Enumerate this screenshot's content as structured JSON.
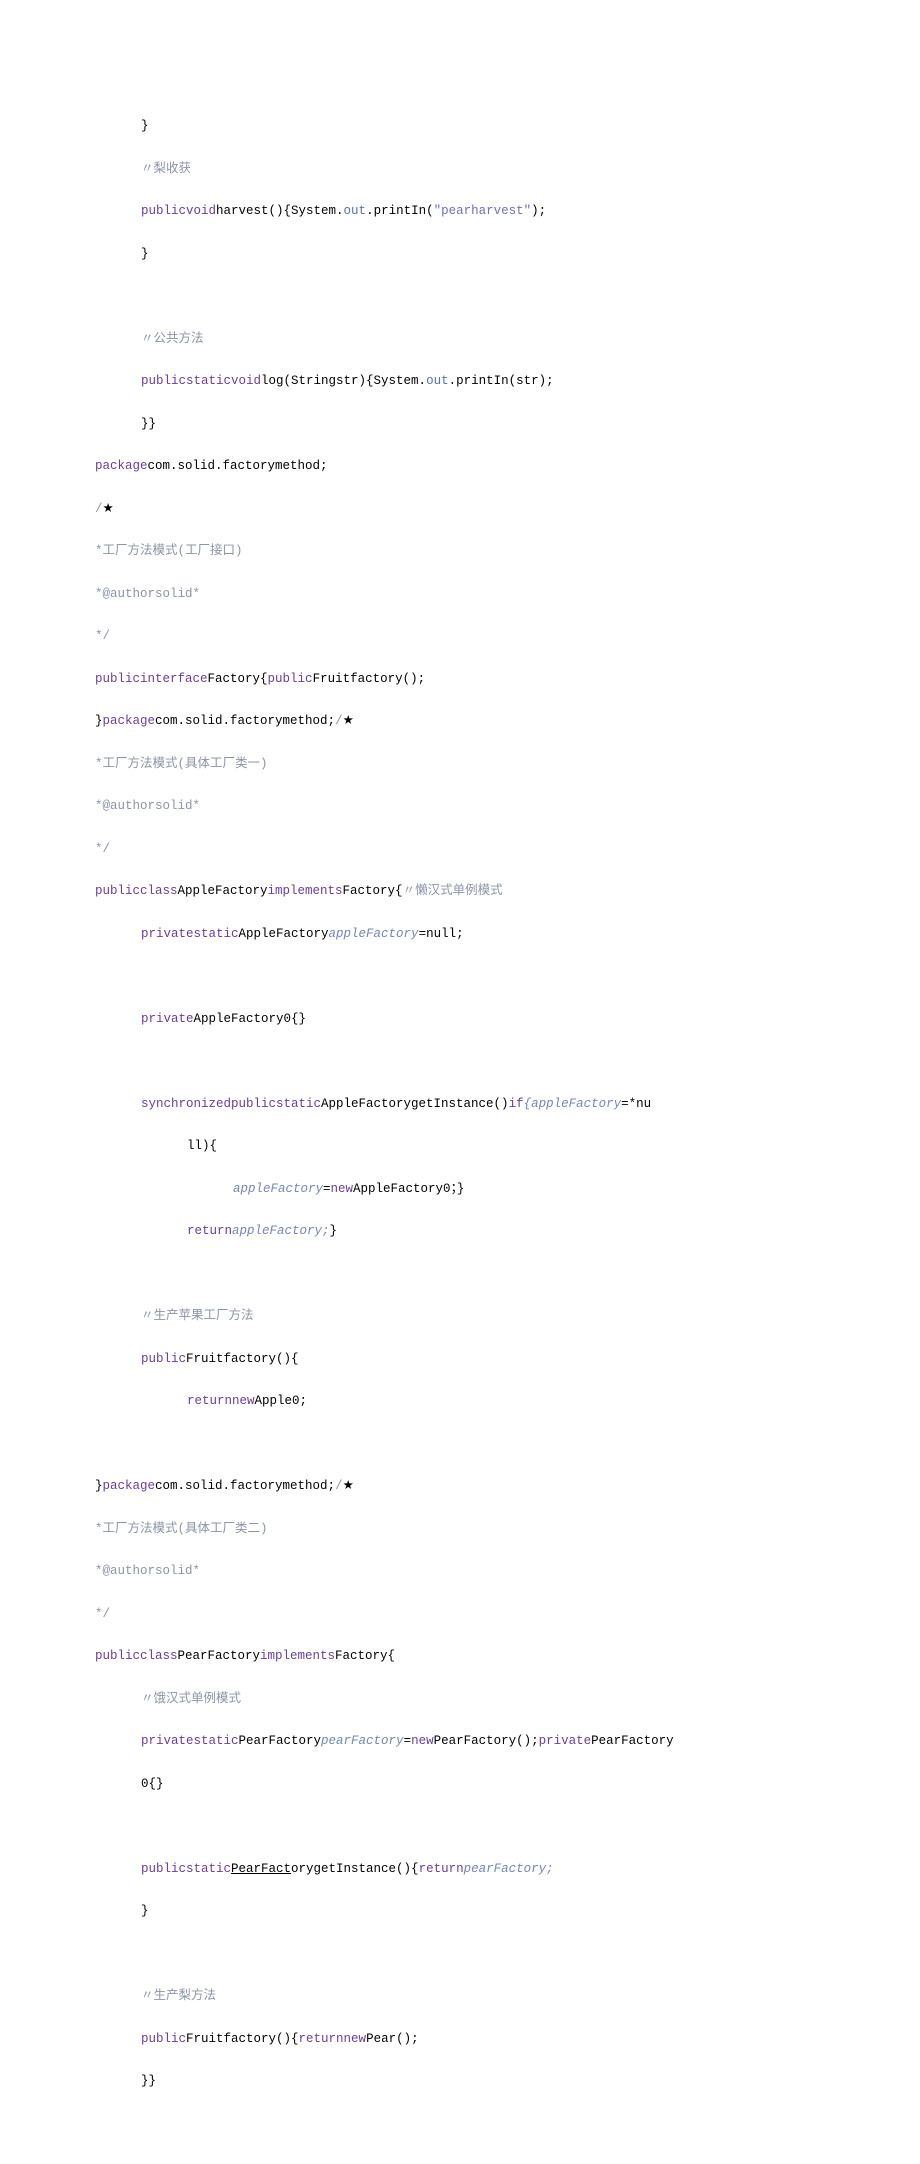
{
  "lines": {
    "l1": "}",
    "l2_cmt": "〃梨收获",
    "l3_a": "publicvoid",
    "l3_b": "harvest(){System.",
    "l3_c": "out",
    "l3_d": ".printIn(",
    "l3_e": "\"pearharvest\"",
    "l3_f": ");",
    "l4": "}",
    "l5_cmt": "〃公共方法",
    "l6_a": "publicstaticvoid",
    "l6_b": "log(Stringstr){System.",
    "l6_c": "out",
    "l6_d": ".printIn(str);",
    "l7": "}}",
    "l8_a": "package",
    "l8_b": "com.solid.factorymethod;",
    "l9_a": "/",
    "l9_star": "★",
    "l10": "*工厂方法模式(工厂接口)",
    "l11_a": "*",
    "l11_b": "@authorsolid",
    "l11_c": "*",
    "l12": "*/",
    "l13_a": "publicinterface",
    "l13_b": "Factory{",
    "l13_c": "public",
    "l13_d": "Fruitfactory();",
    "l14_a": "}",
    "l14_b": "package",
    "l14_c": "com.solid.factorymethod;",
    "l14_d": "/",
    "l14_star": "★",
    "l15": "*工厂方法模式(具体工厂类一)",
    "l16_a": "*",
    "l16_b": "@authorsolid",
    "l16_c": "*",
    "l17": "*/",
    "l18_a": "publicclass",
    "l18_b": "AppleFactory",
    "l18_c": "implements",
    "l18_d": "Factory{",
    "l18_e": "〃懒汉式单例模式",
    "l19_a": "privatestatic",
    "l19_b": "AppleFactory",
    "l19_c": "appleFactory",
    "l19_d": "=null;",
    "l20_a": "private",
    "l20_b": "AppleFactory0{}",
    "l21_a": "synchronizedpublicstatic",
    "l21_b": "AppleFactorygetInstance()",
    "l21_c": "if",
    "l21_d": "{appleFactory",
    "l21_e": "=*nu",
    "l22": "ll){",
    "l23_a": "appleFactory",
    "l23_b": "=",
    "l23_c": "new",
    "l23_d": "AppleFactory0；}",
    "l24_a": "return",
    "l24_b": "appleFactory;",
    "l24_c": "}",
    "l25_cmt": "〃生产苹果工厂方法",
    "l26_a": "public",
    "l26_b": "Fruitfactory(){",
    "l27_a": "returnnew",
    "l27_b": "Apple0;",
    "l28_a": "}",
    "l28_b": "package",
    "l28_c": "com.solid.factorymethod;",
    "l28_d": "/",
    "l28_star": "★",
    "l29": "*工厂方法模式(具体工厂类二)",
    "l30_a": "*",
    "l30_b": "@authorsolid",
    "l30_c": "*",
    "l31": "*/",
    "l32_a": "publicclass",
    "l32_b": "PearFactory",
    "l32_c": "implements",
    "l32_d": "Factory{",
    "l33_cmt": "〃饿汉式单例模式",
    "l34_a": "privatestatic",
    "l34_b": "PearFactory",
    "l34_c": "pearFactory",
    "l34_d": "=",
    "l34_e": "new",
    "l34_f": "PearFactory();",
    "l34_g": "private",
    "l34_h": "PearFactory",
    "l35": "0{}",
    "l36_a": "publicstatic",
    "l36_b": "PearFact",
    "l36_c": "orygetInstance(){",
    "l36_d": "return",
    "l36_e": "pearFactory;",
    "l37": "}",
    "l38_cmt": "〃生产梨方法",
    "l39_a": "public",
    "l39_b": "Fruitfactory(){",
    "l39_c": "returnnew",
    "l39_d": "Pear();",
    "l40": "}}"
  }
}
